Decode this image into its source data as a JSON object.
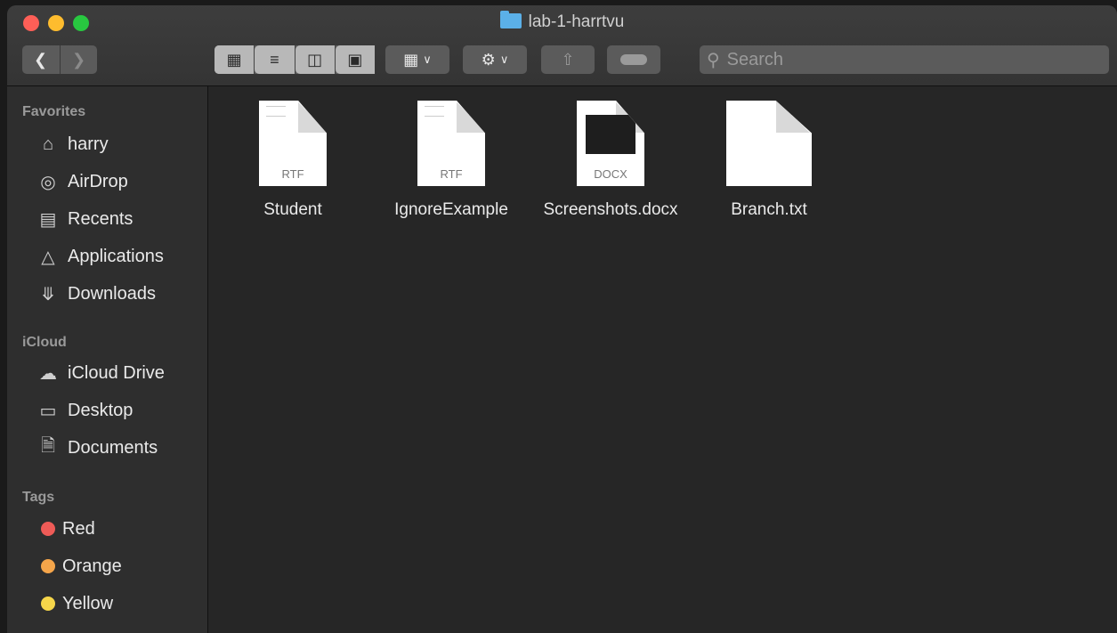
{
  "window": {
    "title": "lab-1-harrtvu"
  },
  "toolbar": {
    "back_icon": "chevron-left-icon",
    "forward_icon": "chevron-right-icon",
    "search_placeholder": "Search"
  },
  "sidebar": {
    "favorites_label": "Favorites",
    "favorites": [
      {
        "label": "harry",
        "icon": "home-icon"
      },
      {
        "label": "AirDrop",
        "icon": "airdrop-icon"
      },
      {
        "label": "Recents",
        "icon": "recents-icon"
      },
      {
        "label": "Applications",
        "icon": "applications-icon"
      },
      {
        "label": "Downloads",
        "icon": "downloads-icon"
      }
    ],
    "icloud_label": "iCloud",
    "icloud": [
      {
        "label": "iCloud Drive",
        "icon": "cloud-icon"
      },
      {
        "label": "Desktop",
        "icon": "desktop-icon"
      },
      {
        "label": "Documents",
        "icon": "documents-icon"
      }
    ],
    "tags_label": "Tags",
    "tags": [
      {
        "label": "Red",
        "color": "#ee5b57"
      },
      {
        "label": "Orange",
        "color": "#f5a54a"
      },
      {
        "label": "Yellow",
        "color": "#f6d64a"
      }
    ]
  },
  "files": [
    {
      "name": "Student",
      "ext": "RTF"
    },
    {
      "name": "IgnoreExample",
      "ext": "RTF"
    },
    {
      "name": "Screenshots.docx",
      "ext": "DOCX"
    },
    {
      "name": "Branch.txt",
      "ext": ""
    }
  ]
}
